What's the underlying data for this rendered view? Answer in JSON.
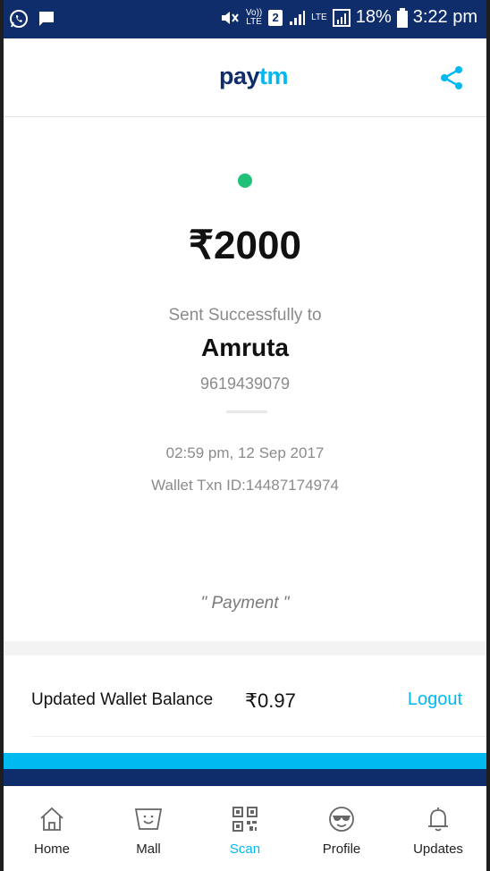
{
  "status_bar": {
    "left_icons": [
      "whatsapp-icon",
      "message-icon"
    ],
    "volte": "Vo)) LTE",
    "sim": "2",
    "lte": "LTE",
    "battery": "18%",
    "time": "3:22 pm"
  },
  "header": {
    "logo_part1": "pay",
    "logo_part2": "tm",
    "share_icon": "share-icon"
  },
  "transaction": {
    "status_dot_color": "#21c17a",
    "amount": "₹2000",
    "sent_label": "Sent Successfully to",
    "recipient_name": "Amruta",
    "recipient_phone": "9619439079",
    "datetime": "02:59 pm, 12 Sep 2017",
    "txn_id": "Wallet Txn ID:14487174974",
    "comment": "\" Payment \""
  },
  "wallet": {
    "label": "Updated Wallet Balance",
    "balance": "₹0.97",
    "logout_label": "Logout"
  },
  "colors": {
    "brand_navy": "#0f2d6b",
    "brand_blue": "#00b9f1"
  },
  "bottom_nav": {
    "items": [
      {
        "label": "Home",
        "icon": "home-icon"
      },
      {
        "label": "Mall",
        "icon": "mall-bag-icon"
      },
      {
        "label": "Scan",
        "icon": "qr-scan-icon",
        "active": true
      },
      {
        "label": "Profile",
        "icon": "profile-sunglasses-icon"
      },
      {
        "label": "Updates",
        "icon": "bell-icon"
      }
    ]
  }
}
